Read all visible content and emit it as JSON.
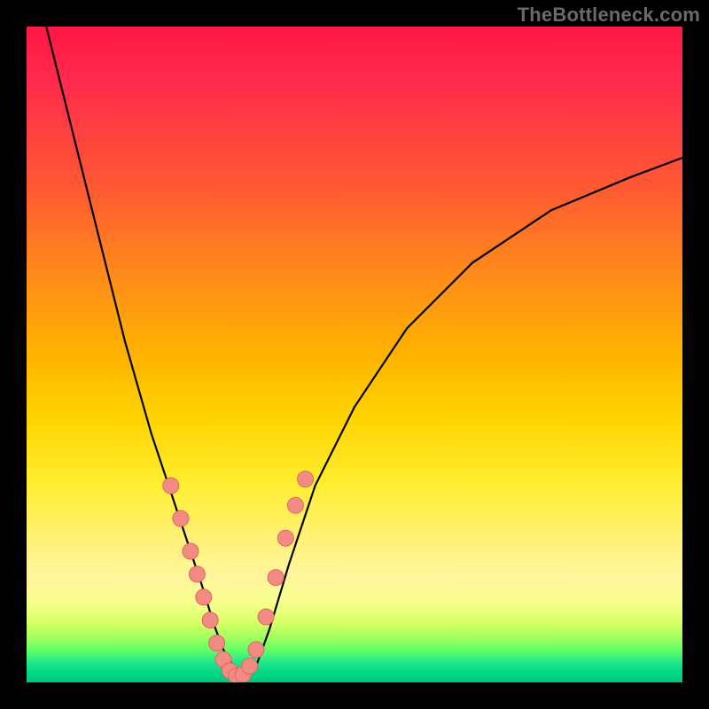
{
  "watermark": "TheBottleneck.com",
  "chart_data": {
    "type": "line",
    "title": "",
    "xlabel": "",
    "ylabel": "",
    "xlim": [
      0,
      100
    ],
    "ylim": [
      0,
      100
    ],
    "grid": false,
    "legend": false,
    "annotations": [
      "TheBottleneck.com"
    ],
    "note": "No axis ticks or numeric labels are rendered in the source image; x/y values below are estimated from pixel positions on a 0–100 normalized scale.",
    "series": [
      {
        "name": "bottleneck-curve",
        "stroke": "#000000",
        "x": [
          3,
          5,
          7,
          9,
          11,
          13,
          15,
          17,
          19,
          21,
          23,
          25,
          27,
          28.5,
          30,
          31.5,
          33,
          35,
          37,
          40,
          44,
          50,
          58,
          68,
          80,
          92,
          100
        ],
        "y": [
          100,
          92,
          84,
          76,
          68,
          60,
          52,
          45,
          38,
          32,
          26,
          20,
          14,
          9,
          5,
          2.5,
          1,
          2.5,
          8,
          18,
          30,
          42,
          54,
          64,
          72,
          77,
          80
        ]
      }
    ],
    "markers": {
      "name": "highlight-dots",
      "fill": "#f28b82",
      "stroke": "#e06666",
      "points": [
        {
          "x": 22,
          "y": 30
        },
        {
          "x": 23.5,
          "y": 25
        },
        {
          "x": 25,
          "y": 20
        },
        {
          "x": 26,
          "y": 16.5
        },
        {
          "x": 27,
          "y": 13
        },
        {
          "x": 28,
          "y": 9.5
        },
        {
          "x": 29,
          "y": 6
        },
        {
          "x": 30,
          "y": 3.5
        },
        {
          "x": 31,
          "y": 1.8
        },
        {
          "x": 32,
          "y": 1
        },
        {
          "x": 33,
          "y": 1.2
        },
        {
          "x": 34,
          "y": 2.5
        },
        {
          "x": 35,
          "y": 5
        },
        {
          "x": 36.5,
          "y": 10
        },
        {
          "x": 38,
          "y": 16
        },
        {
          "x": 39.5,
          "y": 22
        },
        {
          "x": 41,
          "y": 27
        },
        {
          "x": 42.5,
          "y": 31
        }
      ]
    },
    "background_gradient": {
      "direction": "vertical",
      "stops": [
        {
          "pos": 0,
          "color": "#ff1744"
        },
        {
          "pos": 50,
          "color": "#ffd500"
        },
        {
          "pos": 88,
          "color": "#f6ff8a"
        },
        {
          "pos": 100,
          "color": "#00c67a"
        }
      ]
    }
  }
}
